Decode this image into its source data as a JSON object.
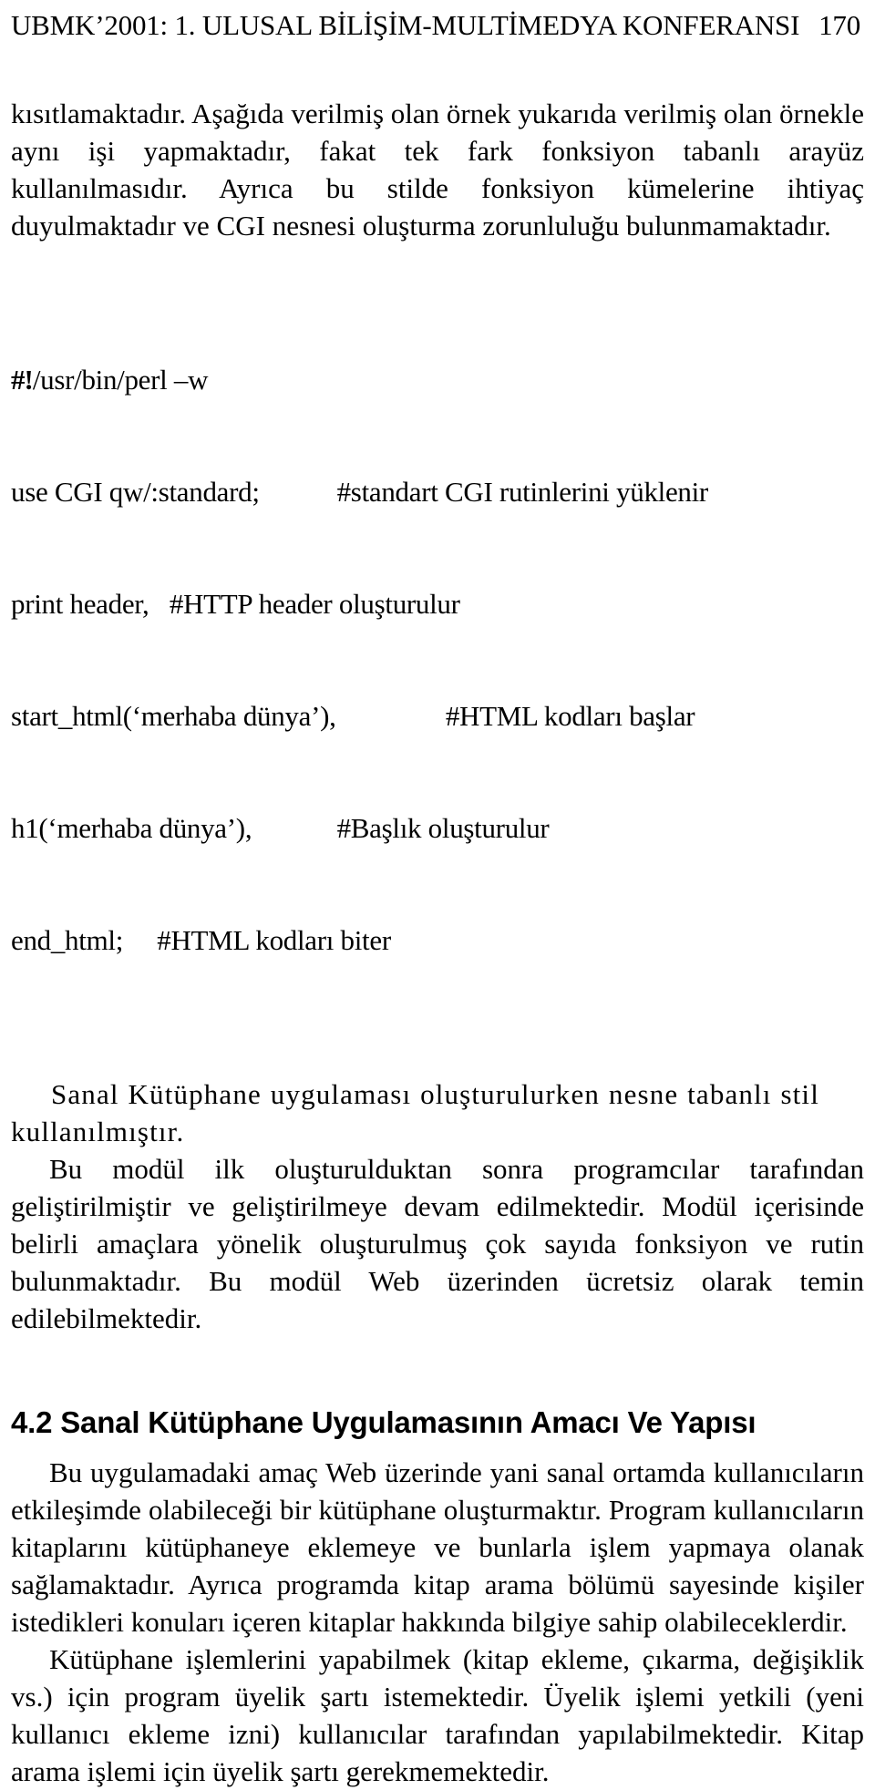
{
  "page": {
    "number": "170",
    "header_title": "UBMK’2001: 1. ULUSAL BİLİŞİM-MULTİMEDYA KONFERANSI"
  },
  "body": {
    "paragraph_1": "kısıtlamaktadır. Aşağıda verilmiş olan örnek yukarıda verilmiş olan örnekle aynı işi yapmaktadır, fakat tek fark fonksiyon tabanlı arayüz kullanılmasıdır. Ayrıca bu stilde fonksiyon kümelerine ihtiyaç duyulmaktadır ve CGI nesnesi oluşturma zorunluluğu bulunmamaktadır.",
    "code_listing": {
      "line_1_prefix": "#!",
      "line_1_rest": "/usr/bin/perl –w",
      "line_2": "use CGI qw/:standard;\t\t#standart CGI rutinlerini yüklenir",
      "line_3": "print header,   #HTTP header oluşturulur",
      "line_4": "start_html(‘merhaba dünya’),\t\t#HTML kodları başlar",
      "line_5": "h1(‘merhaba dünya’),\t\t#Başlık oluşturulur",
      "line_6": "end_html;     #HTML kodları biter"
    },
    "paragraph_2": "Sanal Kütüphane uygulaması oluşturulurken nesne tabanlı stil kullanılmıştır.",
    "paragraph_3": "Bu modül ilk oluşturulduktan sonra programcılar tarafından geliştirilmiştir ve geliştirilmeye devam edilmektedir. Modül içerisinde belirli amaçlara yönelik oluşturulmuş çok sayıda fonksiyon ve rutin bulunmaktadır. Bu modül Web üzerinden ücretsiz olarak temin edilebilmektedir.",
    "section_heading": "4.2  Sanal Kütüphane Uygulamasının Amacı Ve Yapısı",
    "paragraph_4": "Bu uygulamadaki  amaç Web üzerinde yani sanal ortamda kullanıcıların etkileşimde olabileceği bir kütüphane oluşturmaktır. Program kullanıcıların kitaplarını kütüphaneye eklemeye ve bunlarla işlem yapmaya olanak sağlamaktadır. Ayrıca programda kitap arama bölümü sayesinde kişiler istedikleri konuları içeren kitaplar hakkında bilgiye sahip olabileceklerdir.",
    "paragraph_5": "Kütüphane işlemlerini yapabilmek (kitap ekleme, çıkarma, değişiklik vs.) için program üyelik şartı istemektedir. Üyelik işlemi yetkili (yeni kullanıcı ekleme izni) kullanıcılar tarafından yapılabilmektedir. Kitap arama işlemi için üyelik şartı gerekmemektedir."
  }
}
